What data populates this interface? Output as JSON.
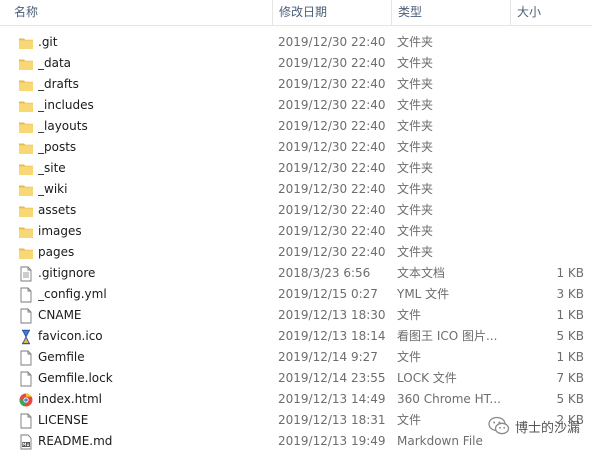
{
  "columns": {
    "name": "名称",
    "date": "修改日期",
    "type": "类型",
    "size": "大小",
    "sort_arrow": "^"
  },
  "files": [
    {
      "name": ".git",
      "date": "2019/12/30 22:40",
      "type": "文件夹",
      "size": "",
      "icon": "folder-icon"
    },
    {
      "name": "_data",
      "date": "2019/12/30 22:40",
      "type": "文件夹",
      "size": "",
      "icon": "folder-icon"
    },
    {
      "name": "_drafts",
      "date": "2019/12/30 22:40",
      "type": "文件夹",
      "size": "",
      "icon": "folder-icon"
    },
    {
      "name": "_includes",
      "date": "2019/12/30 22:40",
      "type": "文件夹",
      "size": "",
      "icon": "folder-icon"
    },
    {
      "name": "_layouts",
      "date": "2019/12/30 22:40",
      "type": "文件夹",
      "size": "",
      "icon": "folder-icon"
    },
    {
      "name": "_posts",
      "date": "2019/12/30 22:40",
      "type": "文件夹",
      "size": "",
      "icon": "folder-icon"
    },
    {
      "name": "_site",
      "date": "2019/12/30 22:40",
      "type": "文件夹",
      "size": "",
      "icon": "folder-icon"
    },
    {
      "name": "_wiki",
      "date": "2019/12/30 22:40",
      "type": "文件夹",
      "size": "",
      "icon": "folder-icon"
    },
    {
      "name": "assets",
      "date": "2019/12/30 22:40",
      "type": "文件夹",
      "size": "",
      "icon": "folder-icon"
    },
    {
      "name": "images",
      "date": "2019/12/30 22:40",
      "type": "文件夹",
      "size": "",
      "icon": "folder-icon"
    },
    {
      "name": "pages",
      "date": "2019/12/30 22:40",
      "type": "文件夹",
      "size": "",
      "icon": "folder-icon"
    },
    {
      "name": ".gitignore",
      "date": "2018/3/23 6:56",
      "type": "文本文档",
      "size": "1 KB",
      "icon": "text-file-icon"
    },
    {
      "name": "_config.yml",
      "date": "2019/12/15 0:27",
      "type": "YML 文件",
      "size": "3 KB",
      "icon": "file-icon"
    },
    {
      "name": "CNAME",
      "date": "2019/12/13 18:30",
      "type": "文件",
      "size": "1 KB",
      "icon": "file-icon"
    },
    {
      "name": "favicon.ico",
      "date": "2019/12/13 18:14",
      "type": "看图王 ICO 图片...",
      "size": "5 KB",
      "icon": "hourglass-icon"
    },
    {
      "name": "Gemfile",
      "date": "2019/12/14 9:27",
      "type": "文件",
      "size": "1 KB",
      "icon": "file-icon"
    },
    {
      "name": "Gemfile.lock",
      "date": "2019/12/14 23:55",
      "type": "LOCK 文件",
      "size": "7 KB",
      "icon": "file-icon"
    },
    {
      "name": "index.html",
      "date": "2019/12/13 14:49",
      "type": "360 Chrome HT...",
      "size": "5 KB",
      "icon": "browser-icon"
    },
    {
      "name": "LICENSE",
      "date": "2019/12/13 18:31",
      "type": "文件",
      "size": "2 KB",
      "icon": "file-icon"
    },
    {
      "name": "README.md",
      "date": "2019/12/13 19:49",
      "type": "Markdown File",
      "size": "",
      "icon": "markdown-file-icon"
    }
  ],
  "watermark": {
    "text": "博士的沙漏",
    "logo_icon": "wechat-logo-icon"
  },
  "colors": {
    "header_text": "#4c607a",
    "folder": "#f8d775",
    "meta_text": "#6d6d6d"
  }
}
